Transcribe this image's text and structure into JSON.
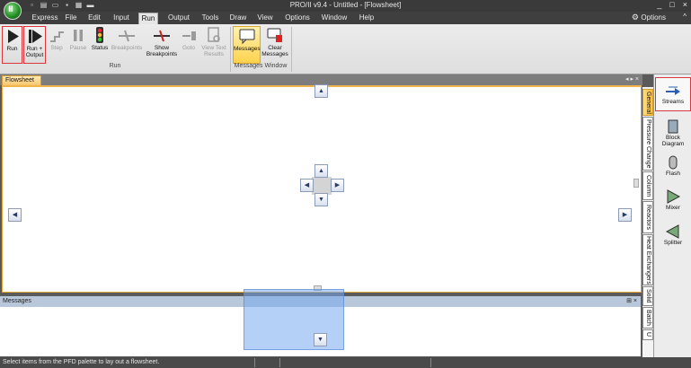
{
  "window": {
    "title": "PRO/II v9.4 - Untitled - [Flowsheet]"
  },
  "app_icon": {
    "glyph": "Ⅱ"
  },
  "quick_access": [
    "new-icon",
    "open-icon",
    "open-folder-icon",
    "save-icon",
    "save-as-icon",
    "print-icon"
  ],
  "menu": {
    "tabs": [
      "Express",
      "File",
      "Edit",
      "Input",
      "Run",
      "Output",
      "Tools",
      "Draw",
      "View",
      "Options",
      "Window",
      "Help"
    ],
    "active": "Run",
    "options_label": "Options",
    "minimize_ribbon": "^",
    "window_controls": [
      "_",
      "□",
      "×"
    ]
  },
  "ribbon": {
    "run_group": {
      "label": "Run",
      "buttons": [
        {
          "label": "Run",
          "state": "enabled"
        },
        {
          "label": "Run + Output",
          "state": "enabled"
        },
        {
          "label": "Step",
          "state": "disabled"
        },
        {
          "label": "Pause",
          "state": "disabled"
        },
        {
          "label": "Status",
          "state": "enabled"
        },
        {
          "label": "Breakpoints",
          "state": "disabled"
        },
        {
          "label": "Show Breakpoints",
          "state": "enabled"
        },
        {
          "label": "Goto",
          "state": "disabled"
        },
        {
          "label": "View Text Results",
          "state": "disabled"
        }
      ]
    },
    "messages_group": {
      "label": "Messages Window",
      "buttons": [
        {
          "label": "Messages",
          "state": "active"
        },
        {
          "label": "Clear Messages",
          "state": "enabled"
        }
      ]
    }
  },
  "document": {
    "tab": "Flowsheet",
    "strip_controls": "◂ ▸ ×"
  },
  "messages_panel": {
    "title": "Messages",
    "controls": "⊞ ×"
  },
  "dock_glyphs": {
    "up": "▲",
    "down": "▼",
    "left": "◀",
    "right": "▶"
  },
  "statusbar": {
    "text": "Select items from the PFD palette to lay out a flowsheet."
  },
  "palette_tabs": [
    "General",
    "Pressure Change",
    "Column",
    "Reactors",
    "Heat Exchangers",
    "Solid",
    "Batch",
    "U"
  ],
  "palette_active_tab": "General",
  "palette_items": [
    "Streams",
    "Block Diagram",
    "Flash",
    "Mixer",
    "Splitter"
  ],
  "colors": {
    "accent": "#ffc23d",
    "highlight_border": "#d9363e",
    "dock_preview": "#78aaf0",
    "message_header": "#b8c7da"
  }
}
